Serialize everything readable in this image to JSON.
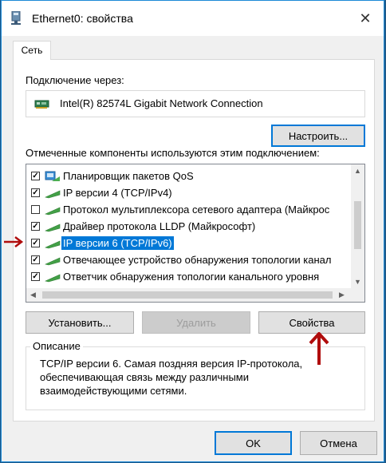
{
  "window": {
    "title": "Ethernet0: свойства"
  },
  "tabs": [
    {
      "label": "Сеть"
    }
  ],
  "connect_using": {
    "label": "Подключение через:",
    "adapter": "Intel(R) 82574L Gigabit Network Connection",
    "configure_button": "Настроить..."
  },
  "components": {
    "label": "Отмеченные компоненты используются этим подключением:",
    "items": [
      {
        "label": "Планировщик пакетов QoS",
        "checked": true,
        "icon": "qos-scheduler-icon"
      },
      {
        "label": "IP версии 4 (TCP/IPv4)",
        "checked": true,
        "icon": "network-protocol-icon"
      },
      {
        "label": "Протокол мультиплексора сетевого адаптера (Майкрос",
        "checked": false,
        "icon": "network-protocol-icon"
      },
      {
        "label": "Драйвер протокола LLDP (Майкрософт)",
        "checked": true,
        "icon": "network-protocol-icon"
      },
      {
        "label": "IP версии 6 (TCP/IPv6)",
        "checked": true,
        "icon": "network-protocol-icon",
        "selected": true
      },
      {
        "label": "Отвечающее устройство обнаружения топологии канал",
        "checked": true,
        "icon": "network-protocol-icon"
      },
      {
        "label": "Ответчик обнаружения топологии канального уровня",
        "checked": true,
        "icon": "network-protocol-icon"
      }
    ]
  },
  "buttons": {
    "install": "Установить...",
    "uninstall": "Удалить",
    "properties": "Свойства",
    "ok": "OK",
    "cancel": "Отмена"
  },
  "description": {
    "legend": "Описание",
    "text": "TCP/IP версии 6. Самая поздняя версия IP-протокола, обеспечивающая связь между различными взаимодействующими сетями."
  },
  "colors": {
    "selection": "#0078d7",
    "annotation_arrow": "#b00d0d",
    "accent_border": "#0078d7"
  }
}
